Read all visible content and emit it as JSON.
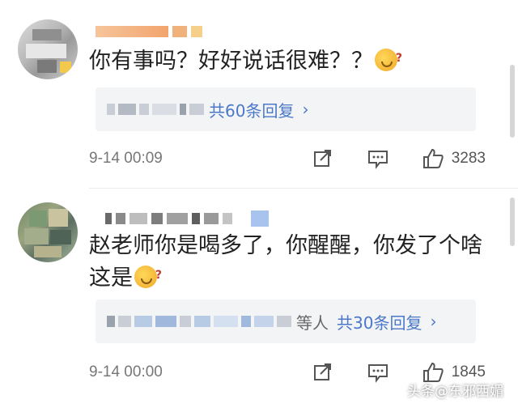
{
  "comments": [
    {
      "text": "你有事吗？好好说话很难？？",
      "replies_label": "共60条回复",
      "timestamp": "9-14 00:09",
      "like_count": "3283"
    },
    {
      "text": "赵老师你是喝多了，你醒醒，你发了个啥这是",
      "replies_prefix": "等人",
      "replies_label": "共30条回复",
      "timestamp": "9-14 00:00",
      "like_count": "1845"
    }
  ],
  "icons": {
    "chevron": "›",
    "share": "share-icon",
    "comment": "comment-icon",
    "like": "thumbs-up-icon"
  },
  "watermark": "头条@东邪西媚",
  "colors": {
    "link": "#4b78c9",
    "reply_bg": "#f3f4f6",
    "text": "#222222",
    "meta": "#777777"
  }
}
